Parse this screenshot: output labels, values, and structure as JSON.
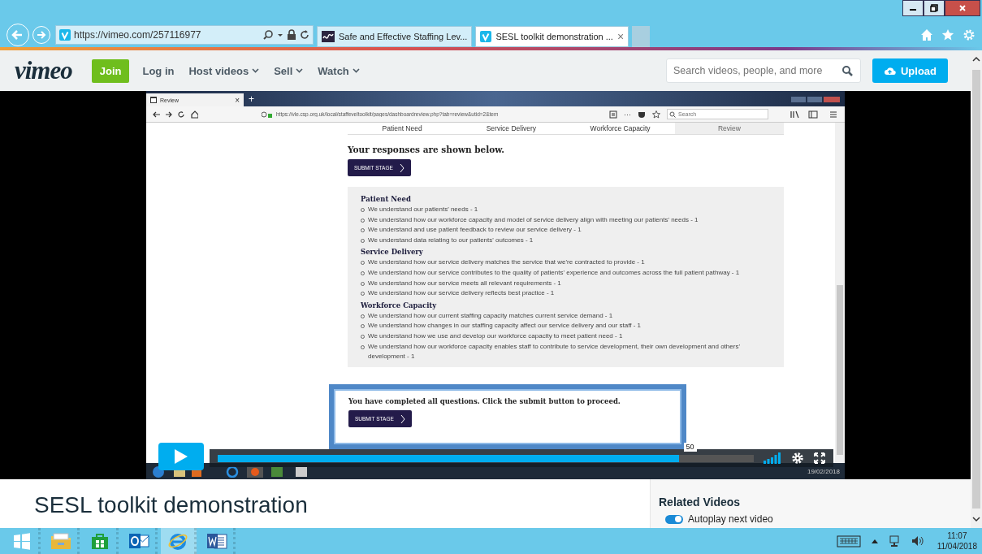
{
  "browser": {
    "address": "https://vimeo.com/257116977",
    "tab_close": "×",
    "tabs": [
      {
        "title": "Safe and Effective Staffing Lev...",
        "kind": "wave",
        "selected": false
      },
      {
        "title": "SESL toolkit demonstration ...",
        "kind": "vimeo",
        "selected": true
      }
    ]
  },
  "site_header": {
    "logo": "vimeo",
    "join": "Join",
    "search_placeholder": "Search videos, people, and more",
    "upload": "Upload",
    "nav": [
      {
        "label": "Log in",
        "dropdown": false
      },
      {
        "label": "Host videos",
        "dropdown": true
      },
      {
        "label": "Sell",
        "dropdown": true
      },
      {
        "label": "Watch",
        "dropdown": true
      }
    ]
  },
  "video": {
    "browser": {
      "tab": "Review",
      "tab_close": "×",
      "new_tab": "+",
      "url": "https://vle.csp.org.uk/local/staffeveltoolkit/pages/dashboardreview.php?tab=review&utid=2&tem",
      "menu": "···",
      "search_placeholder": "Search"
    },
    "page_tabs": [
      {
        "label": "Patient Need",
        "selected": false
      },
      {
        "label": "Service Delivery",
        "selected": false
      },
      {
        "label": "Workforce Capacity",
        "selected": false
      },
      {
        "label": "Review",
        "selected": true
      }
    ],
    "heading": "Your responses are shown below.",
    "submit": "SUBMIT STAGE",
    "sections": [
      {
        "title": "Patient Need",
        "items": [
          "We understand our patients' needs - 1",
          "We understand how our workforce capacity and model of service delivery align with meeting our patients' needs - 1",
          "We understand and use patient feedback to review our service delivery - 1",
          "We understand data relating to our patients' outcomes - 1"
        ]
      },
      {
        "title": "Service Delivery",
        "items": [
          "We understand how our service delivery matches the service that we're contracted to provide - 1",
          "We understand how our service contributes to the quality of patients' experience and outcomes across the full patient pathway - 1",
          "We understand how our service meets all relevant requirements - 1",
          "We understand how our service delivery reflects best practice - 1"
        ]
      },
      {
        "title": "Workforce Capacity",
        "items": [
          "We understand how our current staffing capacity matches current service demand - 1",
          "We understand how changes in our staffing capacity affect our service delivery and our staff - 1",
          "We understand how we use and develop our workforce capacity to meet patient need - 1",
          "We understand how our workforce capacity enables staff to contribute to service development, their own development and others' development - 1"
        ]
      }
    ],
    "notice": "You have completed all questions. Click the submit button to proceed.",
    "notice_submit": "SUBMIT STAGE",
    "taskbar_date": "19/02/2018"
  },
  "player": {
    "level": 0.86,
    "tooltip": "50"
  },
  "title": "SESL toolkit demonstration",
  "related": {
    "title": "Related Videos",
    "autoplay": {
      "label": "Autoplay next video",
      "on": true
    }
  },
  "taskbar": {
    "time": "11:07",
    "date": "11/04/2018",
    "apps": [
      {
        "kind": "explorer",
        "selected": false
      },
      {
        "kind": "store",
        "selected": false
      },
      {
        "kind": "outlook",
        "selected": false
      },
      {
        "kind": "ie",
        "selected": true
      },
      {
        "kind": "word",
        "selected": false
      }
    ]
  }
}
